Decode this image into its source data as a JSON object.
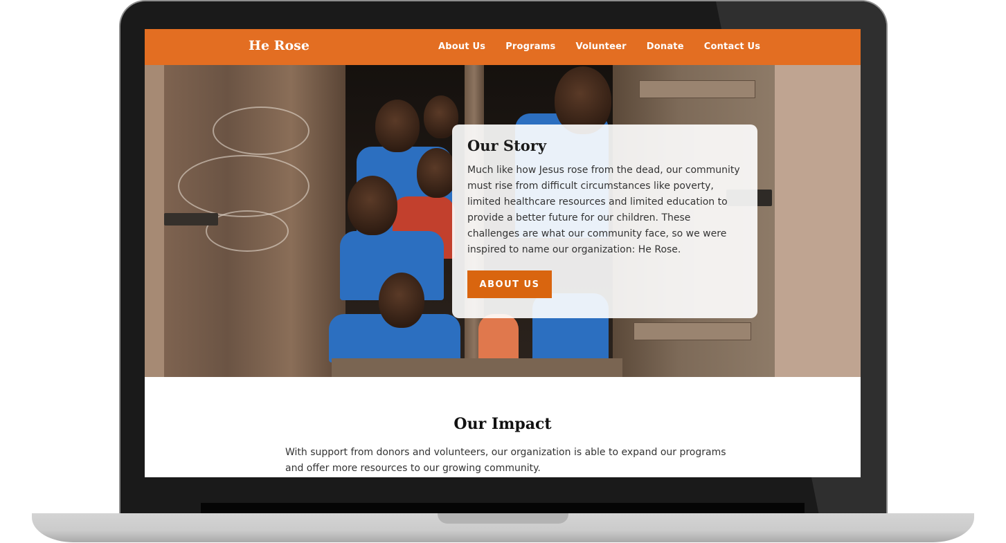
{
  "site": {
    "brand": "He Rose",
    "nav": [
      {
        "label": "About Us"
      },
      {
        "label": "Programs"
      },
      {
        "label": "Volunteer"
      },
      {
        "label": "Donate"
      },
      {
        "label": "Contact Us"
      }
    ],
    "accent_color": "#e36e22",
    "button_color": "#d9650f"
  },
  "hero": {
    "image": "children-smiling-at-window-photo",
    "card": {
      "title": "Our Story",
      "body": "Much like how Jesus rose from the dead, our community must rise from difficult circumstances like poverty, limited healthcare resources and limited education to provide a better future for our children. These challenges are what our community face, so we were inspired to name our organization: He Rose.",
      "button_label": "ABOUT US"
    }
  },
  "impact": {
    "title": "Our Impact",
    "body": "With support from donors and volunteers, our organization is able to expand our programs and offer more resources to our growing community."
  },
  "device": "laptop-mockup"
}
